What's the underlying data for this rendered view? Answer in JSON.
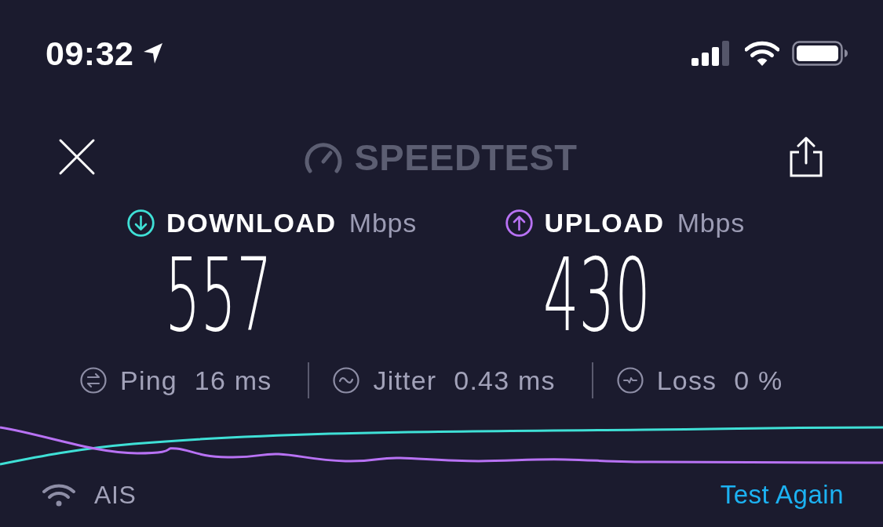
{
  "status_bar": {
    "time": "09:32"
  },
  "header": {
    "logo_text": "SPEEDTEST"
  },
  "results": [
    {
      "kind": "download",
      "label": "DOWNLOAD",
      "unit": "Mbps",
      "value": "557",
      "color": "#3fe0d6"
    },
    {
      "kind": "upload",
      "label": "UPLOAD",
      "unit": "Mbps",
      "value": "430",
      "color": "#b872f4"
    }
  ],
  "metrics": [
    {
      "kind": "ping",
      "label": "Ping",
      "value": "16 ms"
    },
    {
      "kind": "jitter",
      "label": "Jitter",
      "value": "0.43 ms"
    },
    {
      "kind": "loss",
      "label": "Loss",
      "value": "0 %"
    }
  ],
  "network": {
    "name": "AIS"
  },
  "test_again": "Test Again"
}
